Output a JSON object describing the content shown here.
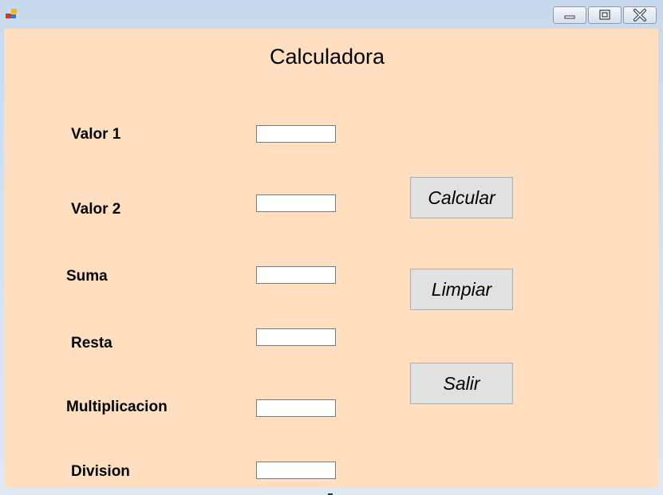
{
  "window": {
    "app_icon": "winforms-app-icon",
    "controls": {
      "minimize": "minimize-icon",
      "maximize": "maximize-icon",
      "close": "close-icon"
    }
  },
  "form": {
    "title": "Calculadora",
    "background": "#ffdfbf",
    "labels": {
      "valor1": "Valor 1",
      "valor2": "Valor 2",
      "suma": "Suma",
      "resta": "Resta",
      "multiplicacion": "Multiplicacion",
      "division": "Division"
    },
    "fields": {
      "valor1": "",
      "valor2": "",
      "suma": "",
      "resta": "",
      "multiplicacion": "",
      "division": ""
    },
    "buttons": {
      "calcular": "Calcular",
      "limpiar": "Limpiar",
      "salir": "Salir"
    }
  }
}
